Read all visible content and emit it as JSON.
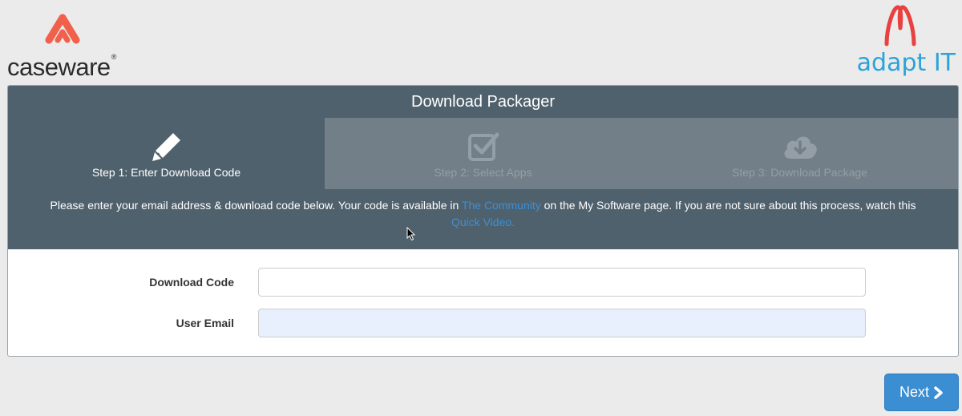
{
  "branding": {
    "left_logo_text": "caseware",
    "left_logo_reg": "®",
    "right_logo_text": "adapt IT",
    "left_accent": "#f0604b",
    "right_accent": "#e8413f",
    "right_text_color": "#2aa3d9"
  },
  "panel": {
    "title": "Download Packager",
    "steps": [
      {
        "label": "Step 1: Enter Download Code",
        "icon": "pencil-icon",
        "state": "active"
      },
      {
        "label": "Step 2: Select Apps",
        "icon": "checkbox-icon",
        "state": "inactive"
      },
      {
        "label": "Step 3: Download Package",
        "icon": "cloud-download-icon",
        "state": "inactive"
      }
    ],
    "instructions": {
      "part1": "Please enter your email address & download code below. Your code is available in ",
      "link1": "The Community",
      "part2": " on the My Software page. If you are not sure about this process, watch this ",
      "link2": "Quick Video."
    }
  },
  "form": {
    "download_code_label": "Download Code",
    "download_code_value": "",
    "user_email_label": "User Email",
    "user_email_value": ""
  },
  "actions": {
    "next_label": "Next"
  },
  "colors": {
    "header_bg": "#4f616c",
    "inactive_step_bg": "#737f88",
    "link": "#3c8fd6",
    "button": "#3b8ed2"
  }
}
